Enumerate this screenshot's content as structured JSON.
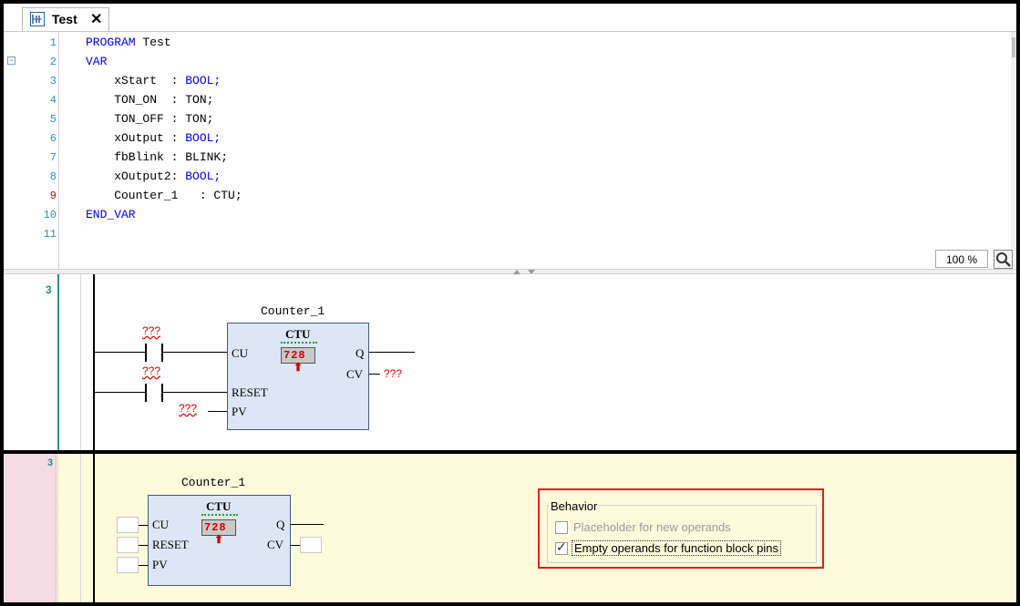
{
  "tab": {
    "label": "Test",
    "close": "✕"
  },
  "code": {
    "lines": [
      {
        "n": "1",
        "kw": "PROGRAM",
        "text": " Test"
      },
      {
        "n": "2",
        "kw": "VAR",
        "text": ""
      },
      {
        "n": "3",
        "text": "    xStart  : ",
        "kw2": "BOOL;"
      },
      {
        "n": "4",
        "text": "    TON_ON  : TON;"
      },
      {
        "n": "5",
        "text": "    TON_OFF : TON;"
      },
      {
        "n": "6",
        "text": "    xOutput : ",
        "kw2": "BOOL;"
      },
      {
        "n": "7",
        "text": "    fbBlink : BLINK;"
      },
      {
        "n": "8",
        "text": "    xOutput2: ",
        "kw2": "BOOL;"
      },
      {
        "n": "9",
        "text": "    Counter_1   : CTU;"
      },
      {
        "n": "10",
        "kw": "END_VAR",
        "text": ""
      },
      {
        "n": "11",
        "text": ""
      }
    ],
    "zoom": "100 %"
  },
  "network1": {
    "number": "3",
    "instance": "Counter_1",
    "fb_type": "CTU",
    "pins": {
      "cu": "CU",
      "reset": "RESET",
      "pv": "PV",
      "q": "Q",
      "cv": "CV"
    },
    "counter_digits": "728",
    "placeholder": "???"
  },
  "network2": {
    "number": "3",
    "instance": "Counter_1",
    "fb_type": "CTU",
    "pins": {
      "cu": "CU",
      "reset": "RESET",
      "pv": "PV",
      "q": "Q",
      "cv": "CV"
    },
    "counter_digits": "728"
  },
  "behavior": {
    "title": "Behavior",
    "options": [
      {
        "label": "Placeholder for new operands",
        "checked": false,
        "enabled": false
      },
      {
        "label": "Empty operands for function block pins",
        "checked": true,
        "enabled": true
      }
    ]
  },
  "colors": {
    "keyword": "#0000ff",
    "linenum": "#2b91af",
    "error": "#e00000",
    "highlight": "#e02020",
    "fb_fill": "#dde6f4"
  }
}
